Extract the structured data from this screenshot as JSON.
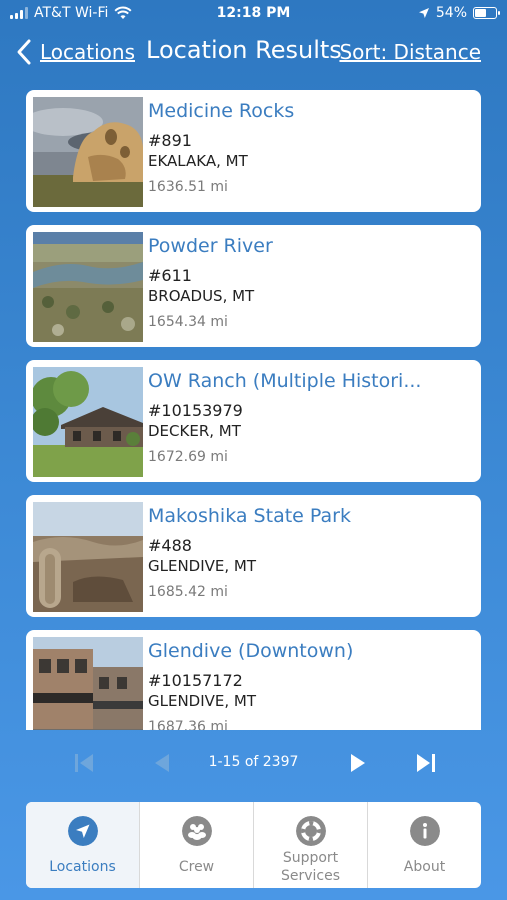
{
  "status_bar": {
    "carrier": "AT&T Wi-Fi",
    "time": "12:18 PM",
    "battery": "54%",
    "battery_level": 0.54
  },
  "nav": {
    "back_label": "Locations",
    "title": "Location Results",
    "sort_label": "Sort: Distance"
  },
  "results": [
    {
      "name": "Medicine Rocks",
      "number": "#891",
      "city": "EKALAKA, MT",
      "distance": "1636.51 mi"
    },
    {
      "name": "Powder River",
      "number": "#611",
      "city": "BROADUS, MT",
      "distance": "1654.34 mi"
    },
    {
      "name": "OW Ranch (Multiple Histori...",
      "number": "#10153979",
      "city": "DECKER, MT",
      "distance": "1672.69 mi"
    },
    {
      "name": "Makoshika State Park",
      "number": "#488",
      "city": "GLENDIVE, MT",
      "distance": "1685.42 mi"
    },
    {
      "name": "Glendive (Downtown)",
      "number": "#10157172",
      "city": "GLENDIVE, MT",
      "distance": "1687.36 mi"
    }
  ],
  "pagination": {
    "range_label": "1-15 of 2397"
  },
  "tabs": [
    {
      "label": "Locations",
      "icon": "navigation-arrow-icon",
      "active": true
    },
    {
      "label": "Crew",
      "icon": "people-icon",
      "active": false
    },
    {
      "label": "Support Services",
      "icon": "lifebuoy-icon",
      "active": false
    },
    {
      "label": "About",
      "icon": "info-icon",
      "active": false
    }
  ],
  "colors": {
    "accent": "#3b7dc0",
    "background_top": "#2e78c1",
    "background_bottom": "#4a97e6",
    "tab_icon_inactive": "#8a8a8a"
  }
}
